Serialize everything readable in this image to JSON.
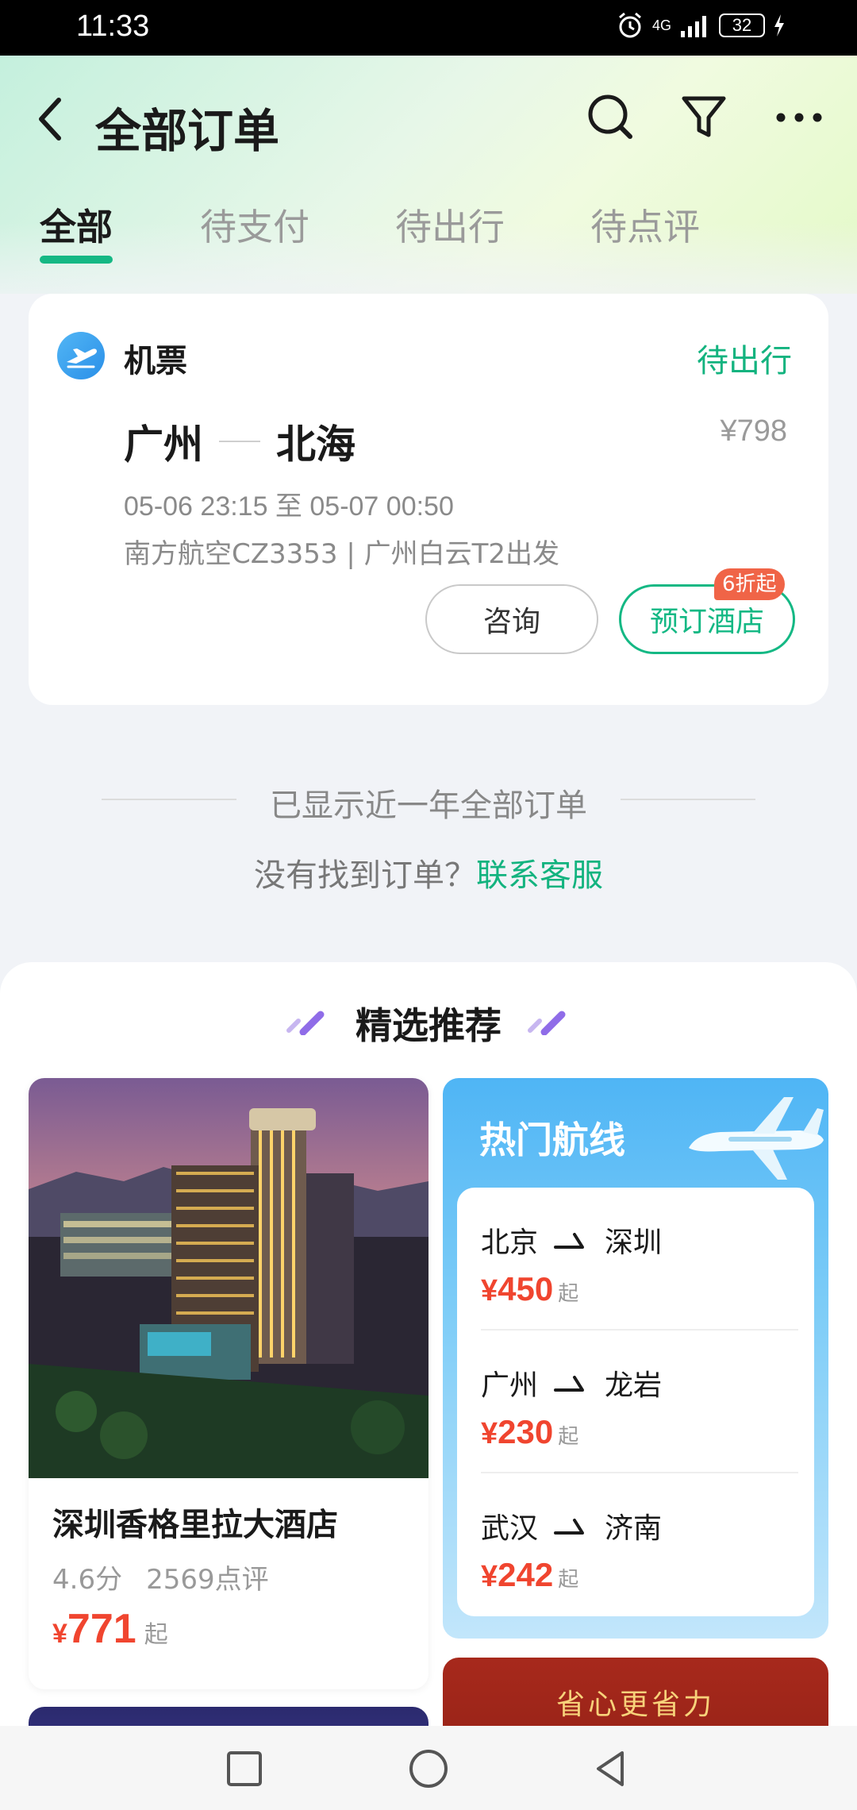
{
  "status_bar": {
    "time": "11:33",
    "network": "4G",
    "battery": "32"
  },
  "header": {
    "title": "全部订单",
    "back_icon": "chevron-left-icon",
    "search_icon": "search-icon",
    "filter_icon": "filter-icon",
    "more_icon": "more-icon"
  },
  "tabs": [
    {
      "label": "全部",
      "active": true
    },
    {
      "label": "待支付",
      "active": false
    },
    {
      "label": "待出行",
      "active": false
    },
    {
      "label": "待点评",
      "active": false
    }
  ],
  "order": {
    "type_label": "机票",
    "status": "待出行",
    "from_city": "广州",
    "to_city": "北海",
    "price": "¥798",
    "time_range": "05-06 23:15 至 05-07 00:50",
    "flight_info": "南方航空CZ3353 | 广州白云T2出发",
    "consult_label": "咨询",
    "hotel_label": "预订酒店",
    "discount_badge": "6折起"
  },
  "footer": {
    "shown_text": "已显示近一年全部订单",
    "notfound_text": "没有找到订单？",
    "contact_link": "联系客服"
  },
  "recommend": {
    "title": "精选推荐",
    "hotel": {
      "name": "深圳香格里拉大酒店",
      "score": "4.6分",
      "reviews": "2569点评",
      "currency": "¥",
      "price": "771",
      "from": "起"
    },
    "hot_routes": {
      "title": "热门航线",
      "items": [
        {
          "from": "北京",
          "to": "深圳",
          "currency": "¥",
          "price": "450",
          "suffix": "起"
        },
        {
          "from": "广州",
          "to": "龙岩",
          "currency": "¥",
          "price": "230",
          "suffix": "起"
        },
        {
          "from": "武汉",
          "to": "济南",
          "currency": "¥",
          "price": "242",
          "suffix": "起"
        }
      ]
    },
    "promo_text": "省心更省力"
  },
  "colors": {
    "accent_green": "#13b37f",
    "price_red": "#f0452f",
    "badge_red": "#f06447"
  }
}
